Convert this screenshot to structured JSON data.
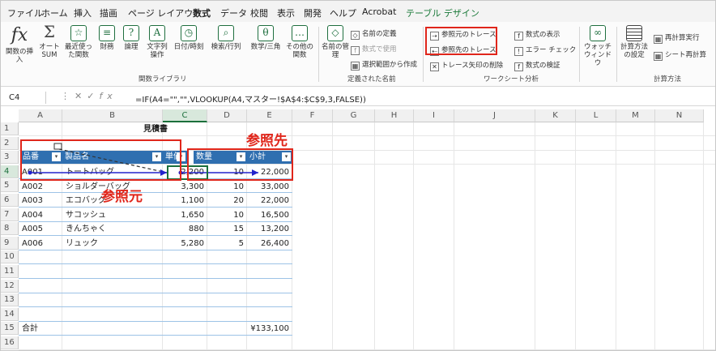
{
  "tabs": [
    "ファイル",
    "ホーム",
    "挿入",
    "描画",
    "ページ レイアウト",
    "数式",
    "データ",
    "校閲",
    "表示",
    "開発",
    "ヘルプ",
    "Acrobat",
    "テーブル デザイン"
  ],
  "ribbon": {
    "insert_function": "関数の挿入",
    "autosum": "オート SUM",
    "recent": "最近使った関数",
    "financial": "財務",
    "logical": "論理",
    "text": "文字列操作",
    "datetime": "日付/時刻",
    "lookup": "検索/行列",
    "math": "数学/三角",
    "more": "その他の関数",
    "group_library": "関数ライブラリ",
    "name_manager": "名前の管理",
    "define_name": "名前の定義",
    "use_in_formula": "数式で使用",
    "create_from_selection": "選択範囲から作成",
    "group_names": "定義された名前",
    "trace_precedents": "参照元のトレース",
    "trace_dependents": "参照先のトレース",
    "remove_arrows": "トレース矢印の削除",
    "show_formulas": "数式の表示",
    "error_check": "エラー チェック",
    "evaluate": "数式の検証",
    "group_audit": "ワークシート分析",
    "watch": "ウォッチ ウィンドウ",
    "calc_options": "計算方法の設定",
    "calc_now": "再計算実行",
    "calc_sheet": "シート再計算",
    "group_calc": "計算方法"
  },
  "namebox": "C4",
  "formula": "=IF(A4=\"\",\"\",VLOOKUP(A4,マスター!$A$4:$C$9,3,FALSE))",
  "columns": [
    "A",
    "B",
    "C",
    "D",
    "E",
    "F",
    "G",
    "H",
    "I",
    "J",
    "K",
    "L",
    "M",
    "N"
  ],
  "rows": [
    "1",
    "2",
    "3",
    "4",
    "5",
    "6",
    "7",
    "8",
    "9",
    "10",
    "11",
    "12",
    "13",
    "14",
    "15",
    "16"
  ],
  "sheet_title": "見積書",
  "headers": [
    "品番",
    "製品名",
    "単価",
    "数量",
    "小計"
  ],
  "data": [
    [
      "A001",
      "トートバッグ",
      "2,200",
      "10",
      "22,000"
    ],
    [
      "A002",
      "ショルダーバッグ",
      "3,300",
      "10",
      "33,000"
    ],
    [
      "A003",
      "エコバッグ",
      "1,100",
      "20",
      "22,000"
    ],
    [
      "A004",
      "サコッシュ",
      "1,650",
      "10",
      "16,500"
    ],
    [
      "A005",
      "きんちゃく",
      "880",
      "15",
      "13,200"
    ],
    [
      "A006",
      "リュック",
      "5,280",
      "5",
      "26,400"
    ]
  ],
  "total_label": "合計",
  "total_value": "¥133,100",
  "annotation_precedent": "参照元",
  "annotation_dependent": "参照先",
  "colors": {
    "accent": "#1b6f3b",
    "table_header": "#2f6fb0",
    "annotation": "#e0261b",
    "arrow": "#2222cc"
  }
}
